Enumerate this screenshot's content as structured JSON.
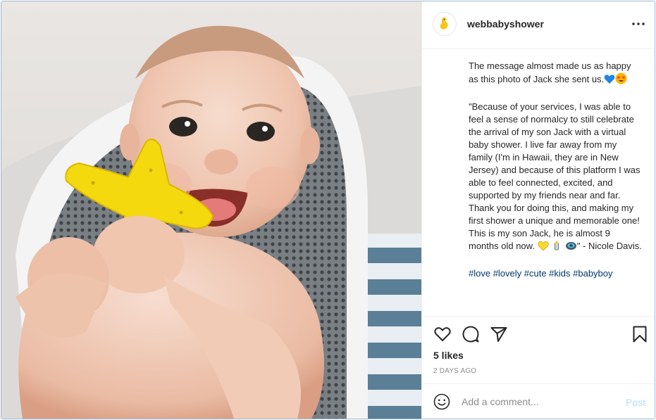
{
  "post": {
    "username": "webbabyshower",
    "avatar_icon": "yellow-duck-icon",
    "more_icon": "ellipsis-icon"
  },
  "caption": {
    "intro_line": "The message almost made us as happy as this photo of Jack she sent us.",
    "intro_emojis": [
      "blue-heart-emoji",
      "star-struck-emoji"
    ],
    "quote": "\"Because of your services, I was able to feel a sense of normalcy to still celebrate the arrival of my son Jack with a virtual baby shower. I live far away from my family (I'm in Hawaii, they are in New Jersey) and because of this platform I was able to feel connected, excited, and supported by my friends near and far. Thank you for doing this, and making my first shower a unique and memorable one! This is my son Jack, he is almost 9 months old now.",
    "quote_emojis": [
      "yellow-heart-emoji",
      "baby-bottle-emoji",
      "rattle-emoji"
    ],
    "quote_end": "\" - Nicole Davis.",
    "hashtags": "#love #lovely #cute #kids #babyboy"
  },
  "actions": {
    "like_icon": "heart-icon",
    "comment_icon": "comment-bubble-icon",
    "share_icon": "paper-plane-icon",
    "save_icon": "bookmark-icon",
    "likes": "5 likes",
    "timestamp": "2 DAYS AGO"
  },
  "comment": {
    "emoji_icon": "smiley-icon",
    "placeholder": "Add a comment...",
    "post_label": "Post"
  },
  "colors": {
    "accent_link": "#00376b",
    "post_disabled": "#b2dffc",
    "border": "#efefef"
  }
}
